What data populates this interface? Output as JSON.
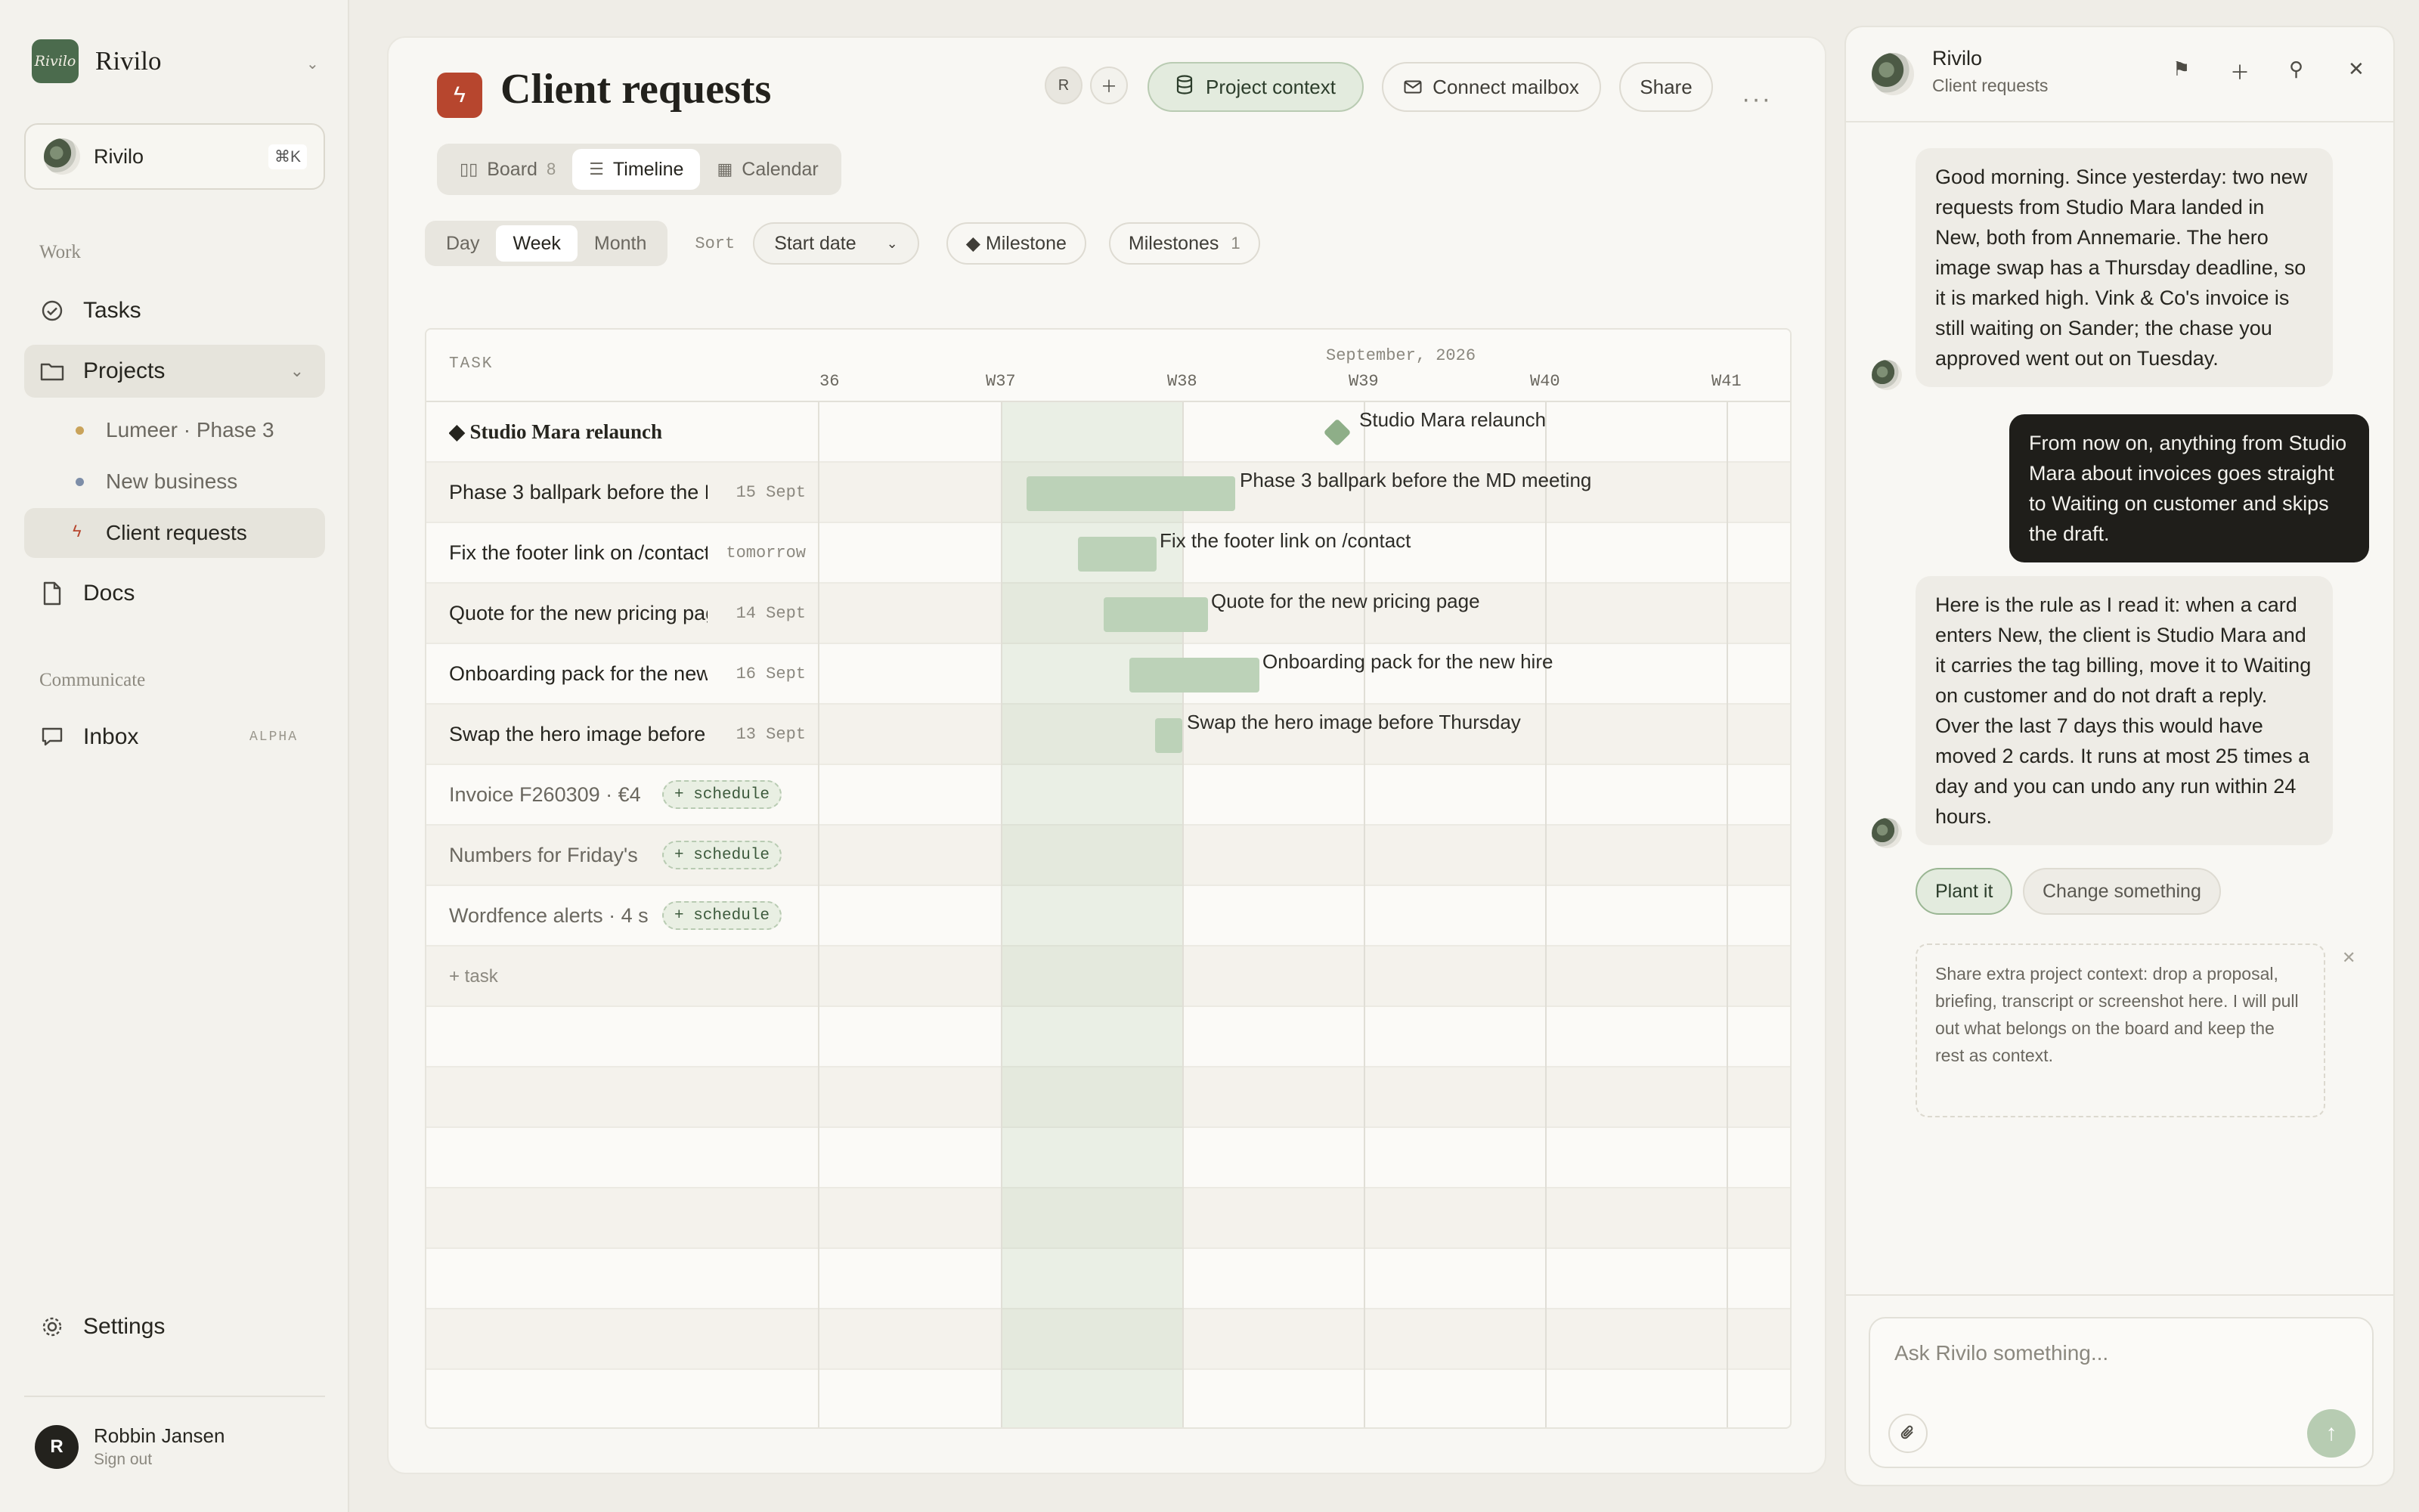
{
  "sidebar": {
    "brand": {
      "logo_text": "Rivilo",
      "name": "Rivilo"
    },
    "search": {
      "label": "Rivilo",
      "shortcut": "⌘K"
    },
    "sections": {
      "work": "Work",
      "communicate": "Communicate"
    },
    "nav": {
      "tasks": "Tasks",
      "projects": "Projects",
      "docs": "Docs",
      "inbox": "Inbox",
      "inbox_badge": "ALPHA",
      "settings": "Settings"
    },
    "projects": [
      {
        "label": "Lumeer · Phase 3",
        "color": "#c9a35a"
      },
      {
        "label": "New business",
        "color": "#7d8ea8"
      },
      {
        "label": "Client requests",
        "color": "#b7462e"
      }
    ],
    "user": {
      "name": "Robbin Jansen",
      "initial": "R",
      "action": "Sign out"
    }
  },
  "main": {
    "title": "Client requests",
    "member_initial": "R",
    "buttons": {
      "project_context": "Project context",
      "connect_mailbox": "Connect mailbox",
      "share": "Share"
    },
    "tabs": [
      {
        "label": "Board",
        "count": "8"
      },
      {
        "label": "Timeline"
      },
      {
        "label": "Calendar"
      }
    ],
    "scale": {
      "options": [
        "Day",
        "Week",
        "Month"
      ],
      "selected": "Week"
    },
    "sort": {
      "label": "Sort",
      "value": "Start date"
    },
    "milestone_chip": "◆ Milestone",
    "milestones_chip": {
      "label": "Milestones",
      "count": "1"
    }
  },
  "timeline": {
    "task_header": "TASK",
    "month": "September, 2026",
    "weeks": [
      "36",
      "W37",
      "W38",
      "W39",
      "W40",
      "W41"
    ],
    "rows": [
      {
        "task": "◆ Studio Mara relaunch",
        "kind": "milestone",
        "label": "Studio Mara relaunch"
      },
      {
        "task": "Phase 3 ballpark before the MD meeting",
        "date": "15 Sept",
        "label": "Phase 3 ballpark before the MD meeting"
      },
      {
        "task": "Fix the footer link on /contact",
        "date": "tomorrow",
        "label": "Fix the footer link on /contact"
      },
      {
        "task": "Quote for the new pricing page",
        "date": "14 Sept",
        "label": "Quote for the new pricing page"
      },
      {
        "task": "Onboarding pack for the new hire",
        "date": "16 Sept",
        "label": "Onboarding pack for the new hire"
      },
      {
        "task": "Swap the hero image before Thursday",
        "date": "13 Sept",
        "label": "Swap the hero image before Thursday"
      },
      {
        "task": "Invoice F260309 · €4",
        "kind": "unscheduled",
        "action": "+ schedule"
      },
      {
        "task": "Numbers for Friday's",
        "kind": "unscheduled",
        "action": "+ schedule"
      },
      {
        "task": "Wordfence alerts · 4 s",
        "kind": "unscheduled",
        "action": "+ schedule"
      }
    ],
    "add_task": "+ task"
  },
  "chat": {
    "title": "Rivilo",
    "subtitle": "Client requests",
    "messages": [
      {
        "role": "assistant",
        "text": "Good morning. Since yesterday: two new requests from Studio Mara landed in New, both from Annemarie. The hero image swap has a Thursday deadline, so it is marked high. Vink & Co's invoice is still waiting on Sander; the chase you approved went out on Tuesday."
      },
      {
        "role": "user",
        "text": "From now on, anything from Studio Mara about invoices goes straight to Waiting on customer and skips the draft."
      },
      {
        "role": "assistant",
        "text": "Here is the rule as I read it: when a card enters New, the client is Studio Mara and it carries the tag billing, move it to Waiting on customer and do not draft a reply. Over the last 7 days this would have moved 2 cards. It runs at most 25 times a day and you can undo any run within 24 hours."
      }
    ],
    "actions": {
      "primary": "Plant it",
      "secondary": "Change something"
    },
    "context_hint": "Share extra project context: drop a proposal, briefing, transcript or screenshot here. I will pull out what belongs on the board and keep the rest as context.",
    "composer_placeholder": "Ask Rivilo something..."
  }
}
